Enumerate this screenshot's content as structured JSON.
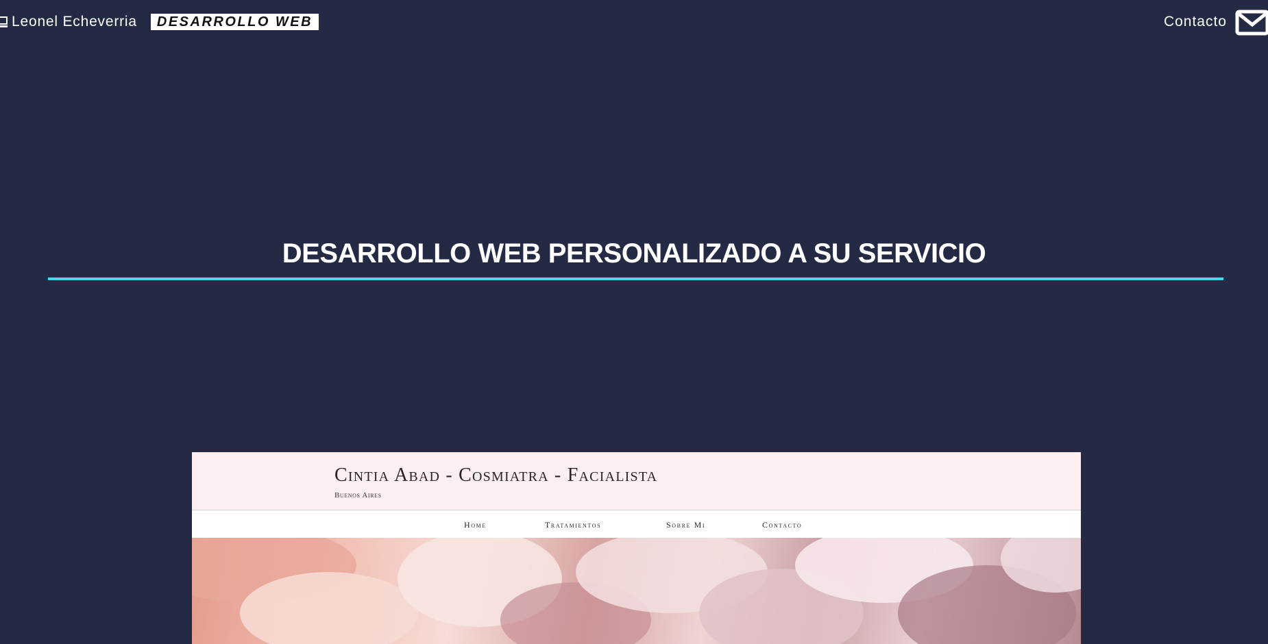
{
  "nav": {
    "brand_name": "Leonel Echeverria",
    "brand_tag": "DESARROLLO WEB",
    "contact_label": "Contacto",
    "brand_icon": "laptop-icon",
    "contact_icon": "mail-icon"
  },
  "hero": {
    "title": "DESARROLLO WEB PERSONALIZADO A SU SERVICIO",
    "accent_color": "#4fd6ec",
    "background_color": "#242944"
  },
  "preview": {
    "site_title": "Cintia Abad - Cosmiatra - Facialista",
    "site_subtitle": "Buenos Aires",
    "menu": [
      "Home",
      "Tratamientos",
      "Sobre Mi",
      "Contacto"
    ],
    "header_color": "#fdeef2"
  }
}
